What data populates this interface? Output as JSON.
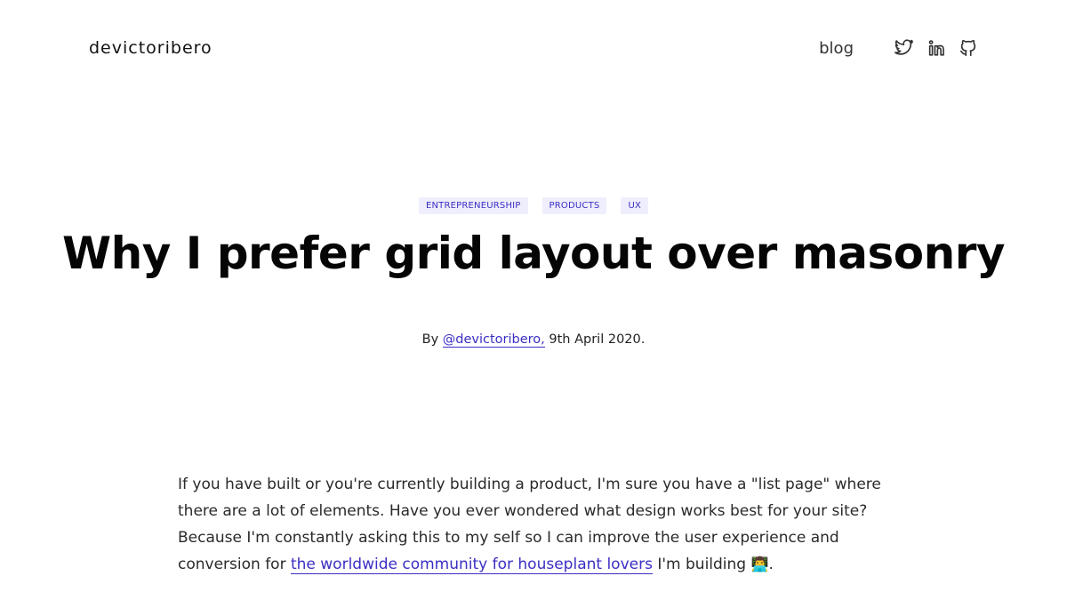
{
  "header": {
    "brand": "devictoribero",
    "nav_blog": "blog",
    "social": {
      "twitter_icon": "twitter-icon",
      "linkedin_icon": "linkedin-icon",
      "github_icon": "github-icon"
    }
  },
  "post": {
    "tags": [
      "ENTREPRENEURSHIP",
      "PRODUCTS",
      "UX"
    ],
    "title": "Why I prefer grid layout over masonry",
    "byline": {
      "prefix": "By ",
      "author_link": "@devictoribero,",
      "date": " 9th April 2020."
    },
    "intro": {
      "text_before_link": "If you have built or you're currently building a product, I'm sure you have a \"list page\" where there are a lot of elements. Have you ever wondered what design works best for your site? Because I'm constantly asking this to my self so I can improve the user experience and conversion for ",
      "link_text": "the worldwide community for houseplant lovers",
      "text_after_link": " I'm building ",
      "emoji": "👨‍💻",
      "end": "."
    }
  },
  "colors": {
    "accent": "#3a2fc4",
    "tag_bg": "#eeeefc",
    "text": "#2a2a2a"
  }
}
